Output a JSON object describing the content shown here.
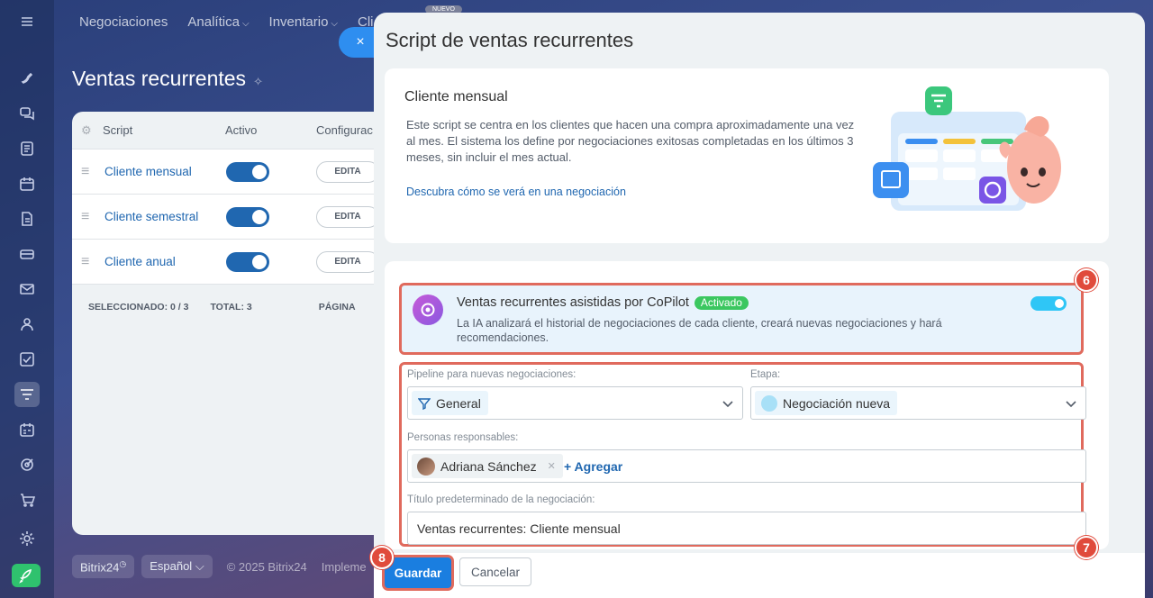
{
  "topnav": {
    "items": [
      "Negociaciones",
      "Analítica",
      "Inventario",
      "Cli"
    ],
    "has_chevron": [
      false,
      true,
      true,
      false
    ],
    "nuevo_tag": "NUEVO"
  },
  "page": {
    "title": "Ventas recurrentes"
  },
  "grid": {
    "headers": {
      "script": "Script",
      "active": "Activo",
      "config": "Configurac"
    },
    "rows": [
      {
        "name": "Cliente mensual",
        "edit_label": "EDITA"
      },
      {
        "name": "Cliente semestral",
        "edit_label": "EDITA"
      },
      {
        "name": "Cliente anual",
        "edit_label": "EDITA"
      }
    ],
    "footer": {
      "selected": "SELECCIONADO: 0 / 3",
      "total": "TOTAL: 3",
      "page": "PÁGINA"
    }
  },
  "bottom_bar": {
    "brand": "Bitrix24",
    "language": "Español",
    "copyright": "© 2025 Bitrix24",
    "implement": "Impleme"
  },
  "slider": {
    "close_icon": "×",
    "title": "Script de ventas recurrentes",
    "info": {
      "title": "Cliente mensual",
      "description": "Este script se centra en los clientes que hacen una compra aproximadamente una vez al mes. El sistema los define por negociaciones exitosas completadas en los últimos 3 meses, sin incluir el mes actual.",
      "link": "Descubra cómo se verá en una negociación"
    },
    "copilot": {
      "title": "Ventas recurrentes asistidas por CoPilot",
      "badge": "Activado",
      "description": "La IA analizará el historial de negociaciones de cada cliente, creará nuevas negociaciones y hará recomendaciones.",
      "enabled": true
    },
    "fields": {
      "pipeline_label": "Pipeline para nuevas negociaciones:",
      "pipeline_value": "General",
      "stage_label": "Etapa:",
      "stage_value": "Negociación nueva",
      "responsible_label": "Personas responsables:",
      "responsible_user": "Adriana Sánchez",
      "add_label": "+ Agregar",
      "deal_title_label": "Título predeterminado de la negociación:",
      "deal_title_value": "Ventas recurrentes: Cliente mensual"
    },
    "buttons": {
      "save": "Guardar",
      "cancel": "Cancelar"
    }
  },
  "callouts": [
    "6",
    "7",
    "8"
  ],
  "colors": {
    "accent": "#1a7ee0",
    "highlight": "#e06a5d",
    "badge_green": "#3bc760",
    "toggle": "#2fc6f6"
  }
}
